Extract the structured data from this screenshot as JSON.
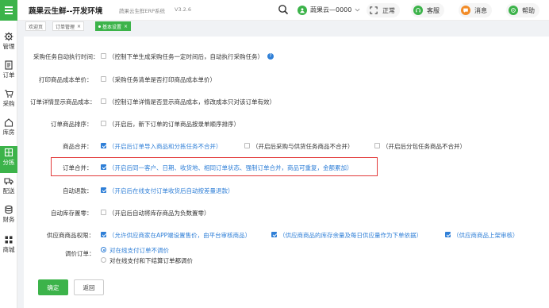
{
  "header": {
    "app_title": "蔬果云生鲜--开发环境",
    "app_subtitle": "蔬果云生鲜ERP系统",
    "version": "V3.2.6",
    "user": "蔬果云—0000",
    "mode_label": "正常",
    "service_label": "客服",
    "message_label": "消息",
    "help_label": "帮助"
  },
  "sidebar": {
    "items": [
      {
        "label": "管理",
        "icon": "gear-icon"
      },
      {
        "label": "订单",
        "icon": "document-icon"
      },
      {
        "label": "采购",
        "icon": "cart-icon"
      },
      {
        "label": "库房",
        "icon": "house-icon"
      },
      {
        "label": "分拣",
        "icon": "sort-icon"
      },
      {
        "label": "配送",
        "icon": "truck-icon"
      },
      {
        "label": "财务",
        "icon": "coins-icon"
      },
      {
        "label": "商城",
        "icon": "grid-icon"
      }
    ]
  },
  "tabs": [
    {
      "label": "欢迎页"
    },
    {
      "label": "订单管理",
      "close": "×"
    },
    {
      "label": "基本设置",
      "close": "×"
    }
  ],
  "settings": {
    "purchase_auto": {
      "label": "采购任务自动执行时间：",
      "note": "（控制下单生成采购任务一定时间后，自动执行采购任务）",
      "help": "?"
    },
    "print_cost": {
      "label": "打印商品成本单价：",
      "note": "（采购任务清单是否打印商品成本单价）"
    },
    "detail_cost": {
      "label": "订单详情显示商品成本：",
      "note": "（控制订单详情是否显示商品成本，修改成本只对该订单有效）"
    },
    "sort": {
      "label": "订单商品排序：",
      "note": "（开启后，新下订单的订单商品按录单顺序排序）"
    },
    "merge_goods": {
      "label": "商品合并：",
      "opt1": "（开启后订单导入商品和分拣任务不合并）",
      "opt2": "（开启后采购与供货任务商品不合并）",
      "opt3": "（开启后分包任务商品不合并）"
    },
    "merge_orders": {
      "label": "订单合并：",
      "note": "（开启后同一客户、日期、收货地、相同订单状态、强制订单合并，商品可重复，金额累加）"
    },
    "auto_return": {
      "label": "自动退款：",
      "note": "（开启后在线支付订单收货后自动按差量退款）"
    },
    "zero_stock": {
      "label": "自动库存置零：",
      "note": "（开启后自动将库存商品为负数置零）"
    },
    "supply_perm": {
      "label": "供应商商品权限：",
      "opt1": "（允许供应商家在APP端设置售价，由平台审核商品）",
      "opt2": "（供应商商品的库存余量及每日供应量作为下单依据）",
      "opt3": "（供应商商品上架审核）"
    },
    "adjust": {
      "label": "调价订单：",
      "opt1": "对在线支付订单不调价",
      "opt2": "对在线支付和下结算订单都调价"
    }
  },
  "buttons": {
    "ok": "确定",
    "back": "返回"
  },
  "colors": {
    "brand": "#3cb34a",
    "link": "#2f7fd7",
    "highlight": "#e23a3a"
  }
}
